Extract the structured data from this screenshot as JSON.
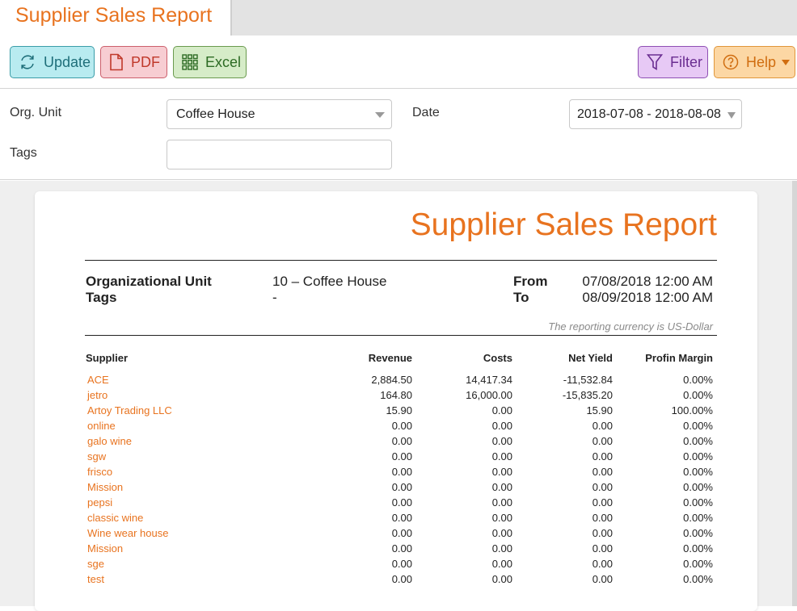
{
  "tab": {
    "title": "Supplier Sales Report"
  },
  "toolbar": {
    "update_label": "Update",
    "pdf_label": "PDF",
    "excel_label": "Excel",
    "filter_label": "Filter",
    "help_label": "Help"
  },
  "form": {
    "org_unit_label": "Org. Unit",
    "org_unit_value": "Coffee House",
    "date_label": "Date",
    "date_value": "2018-07-08 - 2018-08-08",
    "tags_label": "Tags",
    "tags_value": ""
  },
  "report": {
    "title": "Supplier Sales Report",
    "org_unit_label": "Organizational Unit",
    "org_unit_value": "10 – Coffee House",
    "tags_label": "Tags",
    "tags_value": "-",
    "from_label": "From",
    "from_value": "07/08/2018 12:00 AM",
    "to_label": "To",
    "to_value": "08/09/2018 12:00 AM",
    "currency_note": "The reporting currency is US-Dollar",
    "columns": [
      "Supplier",
      "Revenue",
      "Costs",
      "Net Yield",
      "Profin Margin"
    ],
    "rows": [
      [
        "ACE",
        "2,884.50",
        "14,417.34",
        "-11,532.84",
        "0.00%"
      ],
      [
        "jetro",
        "164.80",
        "16,000.00",
        "-15,835.20",
        "0.00%"
      ],
      [
        "Artoy Trading LLC",
        "15.90",
        "0.00",
        "15.90",
        "100.00%"
      ],
      [
        "online",
        "0.00",
        "0.00",
        "0.00",
        "0.00%"
      ],
      [
        "galo wine",
        "0.00",
        "0.00",
        "0.00",
        "0.00%"
      ],
      [
        "sgw",
        "0.00",
        "0.00",
        "0.00",
        "0.00%"
      ],
      [
        "frisco",
        "0.00",
        "0.00",
        "0.00",
        "0.00%"
      ],
      [
        "Mission",
        "0.00",
        "0.00",
        "0.00",
        "0.00%"
      ],
      [
        "pepsi",
        "0.00",
        "0.00",
        "0.00",
        "0.00%"
      ],
      [
        "classic wine",
        "0.00",
        "0.00",
        "0.00",
        "0.00%"
      ],
      [
        "Wine wear house",
        "0.00",
        "0.00",
        "0.00",
        "0.00%"
      ],
      [
        "Mission",
        "0.00",
        "0.00",
        "0.00",
        "0.00%"
      ],
      [
        "sge",
        "0.00",
        "0.00",
        "0.00",
        "0.00%"
      ],
      [
        "test",
        "0.00",
        "0.00",
        "0.00",
        "0.00%"
      ]
    ]
  },
  "colors": {
    "accent": "#e8731f",
    "update": "#b8ebf0",
    "pdf": "#f7cdd2",
    "excel": "#d6ecc8",
    "filter": "#e7c9f5",
    "help": "#fcd7a4"
  }
}
